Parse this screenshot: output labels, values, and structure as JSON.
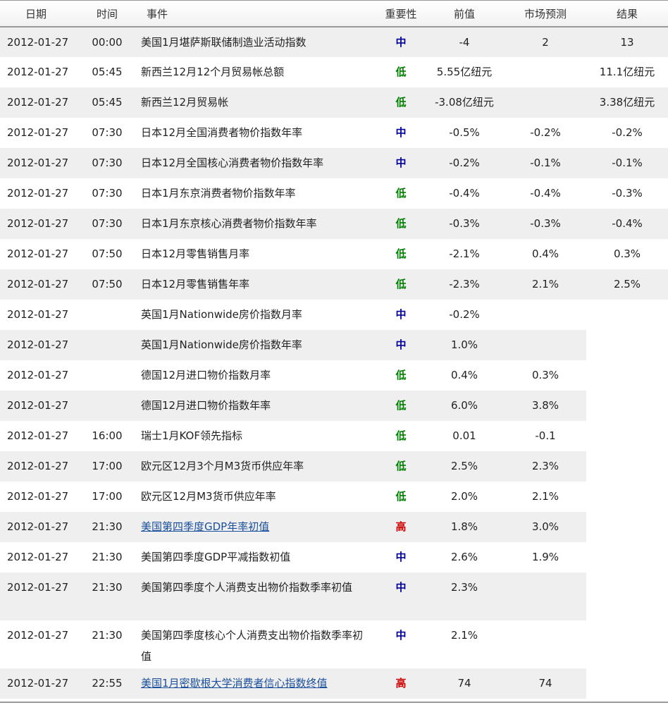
{
  "header": {
    "date": "日期",
    "time": "时间",
    "event": "事件",
    "importance": "重要性",
    "previous": "前值",
    "forecast": "市场预测",
    "result": "结果"
  },
  "colors": {
    "importance_mid": "#000099",
    "importance_low": "#008000",
    "importance_high": "#cc0000",
    "link": "#1a4f9c",
    "row_shade": "#efefef"
  },
  "rows": [
    {
      "date": "2012-01-27",
      "time": "00:00",
      "event": "美国1月堪萨斯联储制造业活动指数",
      "importance": "中",
      "previous": "-4",
      "forecast": "2",
      "result": "13"
    },
    {
      "date": "2012-01-27",
      "time": "05:45",
      "event": "新西兰12月12个月贸易帐总额",
      "importance": "低",
      "previous": "5.55亿纽元",
      "forecast": "",
      "result": "11.1亿纽元"
    },
    {
      "date": "2012-01-27",
      "time": "05:45",
      "event": "新西兰12月贸易帐",
      "importance": "低",
      "previous": "-3.08亿纽元",
      "forecast": "",
      "result": "3.38亿纽元"
    },
    {
      "date": "2012-01-27",
      "time": "07:30",
      "event": "日本12月全国消费者物价指数年率",
      "importance": "中",
      "previous": "-0.5%",
      "forecast": "-0.2%",
      "result": "-0.2%"
    },
    {
      "date": "2012-01-27",
      "time": "07:30",
      "event": "日本12月全国核心消费者物价指数年率",
      "importance": "中",
      "previous": "-0.2%",
      "forecast": "-0.1%",
      "result": "-0.1%"
    },
    {
      "date": "2012-01-27",
      "time": "07:30",
      "event": "日本1月东京消费者物价指数年率",
      "importance": "低",
      "previous": "-0.4%",
      "forecast": "-0.4%",
      "result": "-0.3%"
    },
    {
      "date": "2012-01-27",
      "time": "07:30",
      "event": "日本1月东京核心消费者物价指数年率",
      "importance": "低",
      "previous": "-0.3%",
      "forecast": "-0.3%",
      "result": "-0.4%"
    },
    {
      "date": "2012-01-27",
      "time": "07:50",
      "event": "日本12月零售销售月率",
      "importance": "低",
      "previous": "-2.1%",
      "forecast": "0.4%",
      "result": "0.3%"
    },
    {
      "date": "2012-01-27",
      "time": "07:50",
      "event": "日本12月零售销售年率",
      "importance": "低",
      "previous": "-2.3%",
      "forecast": "2.1%",
      "result": "2.5%"
    },
    {
      "date": "2012-01-27",
      "time": "",
      "event": "英国1月Nationwide房价指数月率",
      "importance": "中",
      "previous": "-0.2%",
      "forecast": "",
      "result": ""
    },
    {
      "date": "2012-01-27",
      "time": "",
      "event": "英国1月Nationwide房价指数年率",
      "importance": "中",
      "previous": "1.0%",
      "forecast": "",
      "result": ""
    },
    {
      "date": "2012-01-27",
      "time": "",
      "event": "德国12月进口物价指数月率",
      "importance": "低",
      "previous": "0.4%",
      "forecast": "0.3%",
      "result": ""
    },
    {
      "date": "2012-01-27",
      "time": "",
      "event": "德国12月进口物价指数年率",
      "importance": "低",
      "previous": "6.0%",
      "forecast": "3.8%",
      "result": ""
    },
    {
      "date": "2012-01-27",
      "time": "16:00",
      "event": "瑞士1月KOF领先指标",
      "importance": "低",
      "previous": "0.01",
      "forecast": "-0.1",
      "result": ""
    },
    {
      "date": "2012-01-27",
      "time": "17:00",
      "event": "欧元区12月3个月M3货币供应年率",
      "importance": "低",
      "previous": "2.5%",
      "forecast": "2.3%",
      "result": ""
    },
    {
      "date": "2012-01-27",
      "time": "17:00",
      "event": "欧元区12月M3货币供应年率",
      "importance": "低",
      "previous": "2.0%",
      "forecast": "2.1%",
      "result": ""
    },
    {
      "date": "2012-01-27",
      "time": "21:30",
      "event": "美国第四季度GDP年率初值",
      "importance": "高",
      "previous": "1.8%",
      "forecast": "3.0%",
      "result": "",
      "link": true
    },
    {
      "date": "2012-01-27",
      "time": "21:30",
      "event": "美国第四季度GDP平减指数初值",
      "importance": "中",
      "previous": "2.6%",
      "forecast": "1.9%",
      "result": ""
    },
    {
      "date": "2012-01-27",
      "time": "21:30",
      "event": "美国第四季度个人消费支出物价指数季率初值",
      "importance": "中",
      "previous": "2.3%",
      "forecast": "",
      "result": "",
      "wrap": true
    },
    {
      "date": "2012-01-27",
      "time": "21:30",
      "event": "美国第四季度核心个人消费支出物价指数季率初值",
      "importance": "中",
      "previous": "2.1%",
      "forecast": "",
      "result": "",
      "wrap": true
    },
    {
      "date": "2012-01-27",
      "time": "22:55",
      "event": "美国1月密歇根大学消费者信心指数终值",
      "importance": "高",
      "previous": "74",
      "forecast": "74",
      "result": "",
      "link": true
    }
  ]
}
